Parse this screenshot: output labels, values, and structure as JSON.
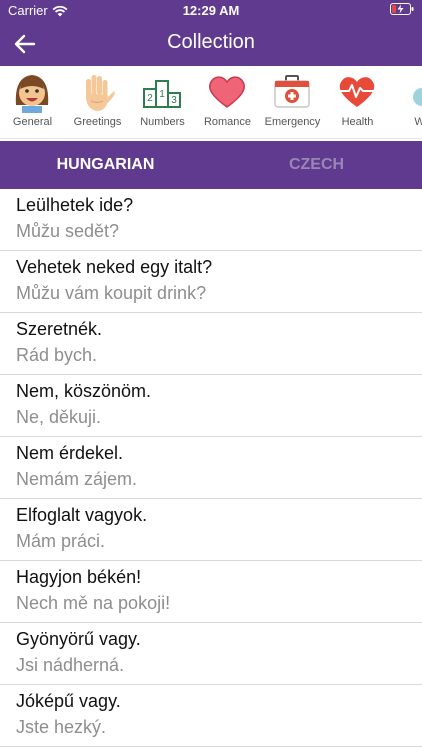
{
  "status": {
    "carrier": "Carrier",
    "time": "12:29 AM"
  },
  "header": {
    "title": "Collection"
  },
  "categories": [
    {
      "label": "General",
      "icon": "smiling-girl-icon"
    },
    {
      "label": "Greetings",
      "icon": "waving-hand-icon"
    },
    {
      "label": "Numbers",
      "icon": "numbers-podium-icon"
    },
    {
      "label": "Romance",
      "icon": "heart-icon"
    },
    {
      "label": "Emergency",
      "icon": "first-aid-kit-icon"
    },
    {
      "label": "Health",
      "icon": "heartbeat-icon"
    },
    {
      "label": "We",
      "icon": "weather-icon"
    }
  ],
  "tabs": {
    "hungarian": "HUNGARIAN",
    "czech": "CZECH"
  },
  "phrases": [
    {
      "source": "Leülhetek ide?",
      "translation": "Můžu sedět?"
    },
    {
      "source": "Vehetek neked egy italt?",
      "translation": "Můžu vám koupit drink?"
    },
    {
      "source": "Szeretnék.",
      "translation": "Rád bych."
    },
    {
      "source": "Nem, köszönöm.",
      "translation": "Ne, děkuji."
    },
    {
      "source": "Nem érdekel.",
      "translation": "Nemám zájem."
    },
    {
      "source": "Elfoglalt vagyok.",
      "translation": "Mám práci."
    },
    {
      "source": "Hagyjon békén!",
      "translation": "Nech mě na pokoji!"
    },
    {
      "source": "Gyönyörű vagy.",
      "translation": "Jsi nádherná."
    },
    {
      "source": "Jóképű vagy.",
      "translation": "Jste hezký."
    }
  ],
  "colors": {
    "primary": "#5f3a8e",
    "translation_text": "#8e8e8e"
  }
}
